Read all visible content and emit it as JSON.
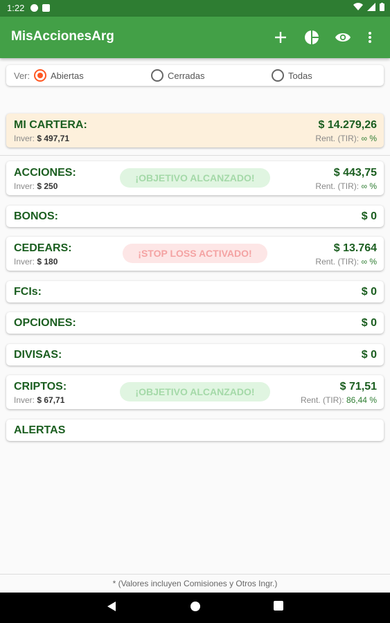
{
  "status_bar": {
    "time": "1:22"
  },
  "app_bar": {
    "title": "MisAccionesArg",
    "actions": [
      "add-icon",
      "pie-chart-icon",
      "eye-icon",
      "more-vert-icon"
    ]
  },
  "filter": {
    "label": "Ver:",
    "options": [
      "Abiertas",
      "Cerradas",
      "Todas"
    ],
    "selected": "Abiertas"
  },
  "summary": {
    "name": "MI CARTERA:",
    "inv_label": "Inver:",
    "inv_value": "$ 497,71",
    "value": "$ 14.279,26",
    "rent_label": "Rent. (TIR):",
    "rent_value": "∞ %"
  },
  "categories": [
    {
      "name": "ACCIONES:",
      "inv_label": "Inver:",
      "inv_value": "$ 250",
      "value": "$ 443,75",
      "rent_label": "Rent. (TIR):",
      "rent_value": "∞ %",
      "badge": "¡OBJETIVO ALCANZADO!"
    },
    {
      "name": "BONOS:",
      "value": "$ 0"
    },
    {
      "name": "CEDEARS:",
      "inv_label": "Inver:",
      "inv_value": "$ 180",
      "value": "$ 13.764",
      "rent_label": "Rent. (TIR):",
      "rent_value": "∞ %",
      "badge": "¡STOP LOSS ACTIVADO!"
    },
    {
      "name": "FCIs:",
      "value": "$ 0"
    },
    {
      "name": "OPCIONES:",
      "value": "$ 0"
    },
    {
      "name": "DIVISAS:",
      "value": "$ 0"
    },
    {
      "name": "CRIPTOS:",
      "inv_label": "Inver:",
      "inv_value": "$ 67,71",
      "value": "$ 71,51",
      "rent_label": "Rent. (TIR):",
      "rent_value": "86,44 %",
      "badge": "¡OBJETIVO ALCANZADO!"
    },
    {
      "name": "ALERTAS"
    }
  ],
  "footer": {
    "note": "* (Valores incluyen Comisiones y Otros Ingr.)"
  },
  "colors": {
    "primary": "#43a047",
    "primary_dark": "#2e7d32",
    "accent": "#ff5722",
    "text_green": "#1b5e20",
    "summary_bg": "#fdf0dc"
  }
}
